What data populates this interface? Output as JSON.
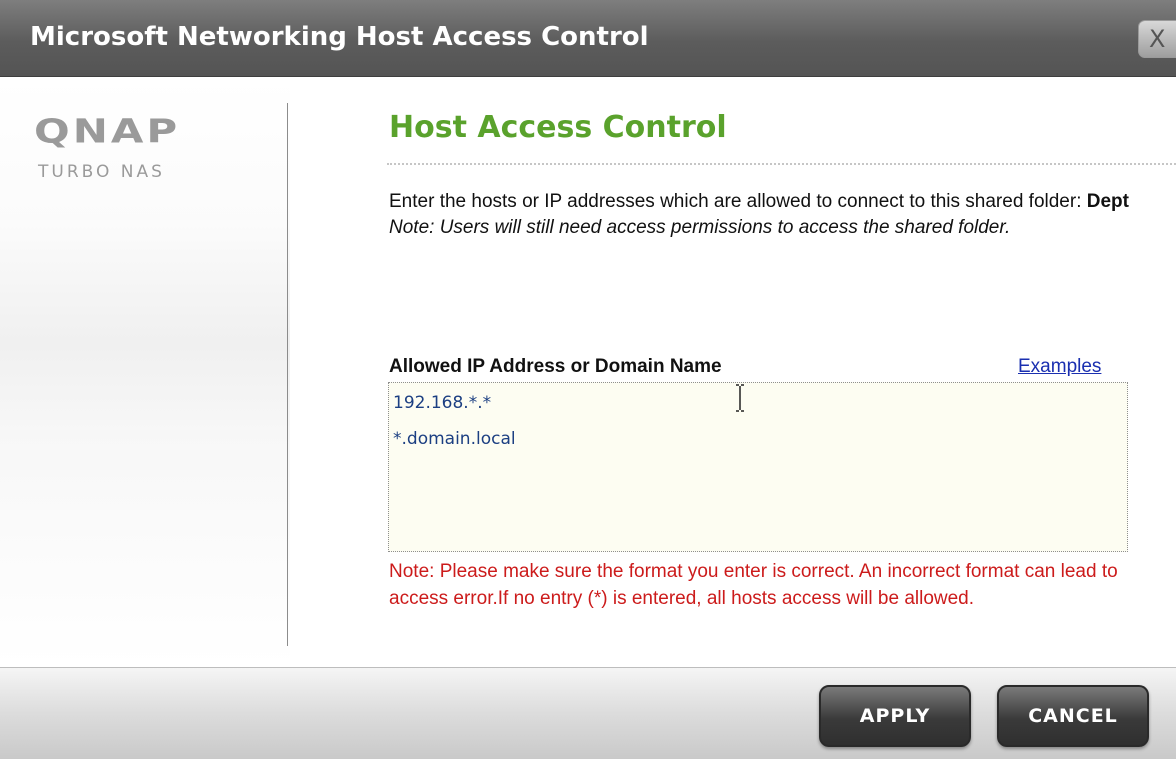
{
  "window": {
    "title": "Microsoft Networking Host Access Control",
    "close_label": "X"
  },
  "brand": {
    "logo": "QNAP",
    "product": "TURBO NAS"
  },
  "main": {
    "heading": "Host Access Control",
    "description_line1": "Enter the hosts or IP addresses which are allowed to connect to this shared folder: ",
    "folder_name": "Dept",
    "note": "Note: Users will still need access permissions to access the shared folder.",
    "list_label": "Allowed IP Address or Domain Name",
    "examples_link": "Examples",
    "entries": [
      "192.168.*.*",
      "*.domain.local"
    ],
    "warning": "Note: Please make sure the format you enter is correct. An incorrect format can lead to access error.If no entry (*) is entered, all hosts access will be allowed."
  },
  "buttons": {
    "apply": "APPLY",
    "cancel": "CANCEL"
  },
  "colors": {
    "heading": "#5aa22c",
    "warning": "#cc1b1b",
    "link": "#1a2fb0",
    "titlebar": "#5c5c5c"
  }
}
